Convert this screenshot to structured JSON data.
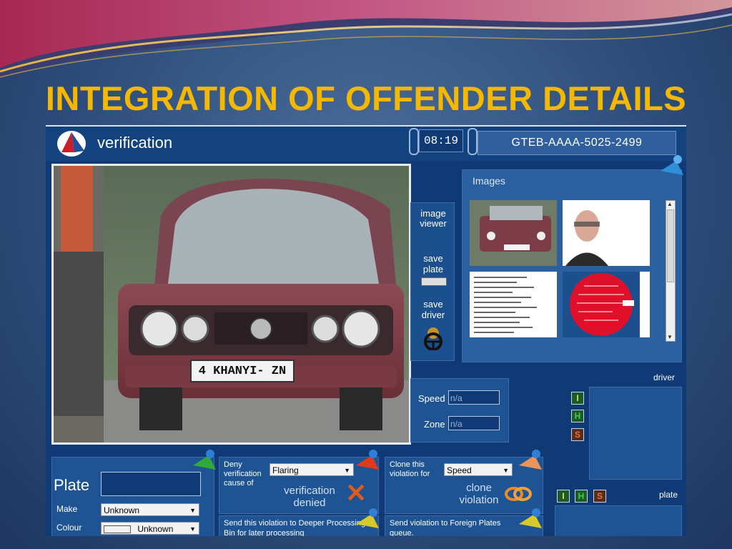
{
  "slide": {
    "title": "INTEGRATION OF OFFENDER DETAILS"
  },
  "app": {
    "name": "verification",
    "time": "08:19",
    "case_number": "GTEB-AAAA-5025-2499"
  },
  "photo": {
    "plate_text": "4 KHANYI- ZN"
  },
  "side_tools": {
    "image_viewer": "image viewer",
    "save_plate": "save plate",
    "save_driver": "save driver"
  },
  "images_panel": {
    "title": "Images"
  },
  "speed": {
    "label": "Speed",
    "value": "n/a"
  },
  "zone": {
    "label": "Zone",
    "value": "n/a"
  },
  "driver_panel": {
    "label": "driver",
    "letters": [
      "I",
      "H",
      "S"
    ]
  },
  "plate_panel": {
    "label": "plate",
    "letters": [
      "I",
      "H",
      "S"
    ]
  },
  "plate_form": {
    "plate_label": "Plate",
    "make_label": "Make",
    "make_value": "Unknown",
    "colour_label": "Colour",
    "colour_value": "Unknown"
  },
  "deny_panel": {
    "text": "Deny verification cause of",
    "select_value": "Flaring",
    "action": "verification denied"
  },
  "clone_panel": {
    "text": "Clone this violation for",
    "select_value": "Speed",
    "action": "clone violation"
  },
  "deeper_panel": {
    "text": "Send this violation to Deeper Processing Bin for later processing"
  },
  "foreign_panel": {
    "text": "Send violation to Foreign Plates queue."
  },
  "colors": {
    "title_yellow": "#f5b800",
    "app_blue": "#0f3a76",
    "letter_i": "#e8e04a",
    "letter_h": "#3fcf3f",
    "letter_s": "#e0782e"
  }
}
